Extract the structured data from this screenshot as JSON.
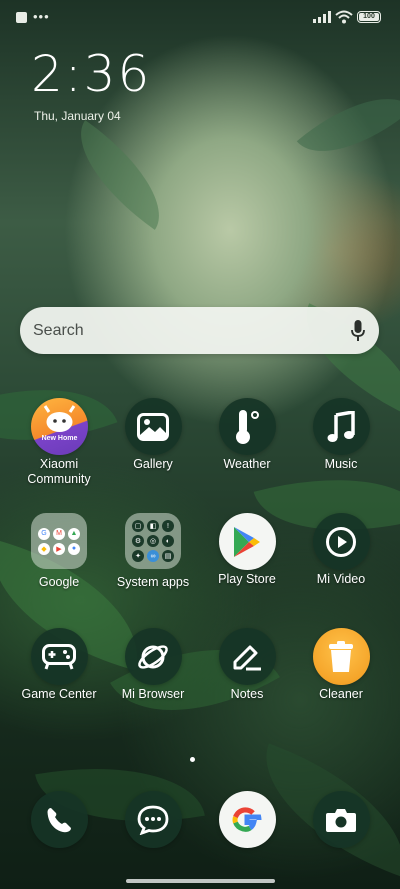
{
  "status_bar": {
    "battery_level": "100",
    "icons": [
      "notification-square-icon",
      "more-dots-icon",
      "signal-icon",
      "wifi-icon",
      "battery-icon"
    ]
  },
  "clock": {
    "time": "2:36",
    "date": "Thu, January 04"
  },
  "search": {
    "placeholder": "Search",
    "icon": "mic-icon"
  },
  "apps": [
    {
      "label_line1": "Xiaomi",
      "label_line2": "Community",
      "badge": "New Home",
      "icon": "xiaomi-community-icon"
    },
    {
      "label_line1": "Gallery",
      "icon": "gallery-icon"
    },
    {
      "label_line1": "Weather",
      "icon": "thermometer-icon"
    },
    {
      "label_line1": "Music",
      "icon": "music-note-icon"
    },
    {
      "label_line1": "Google",
      "icon": "folder-icon"
    },
    {
      "label_line1": "System apps",
      "icon": "folder-icon"
    },
    {
      "label_line1": "Play Store",
      "icon": "play-store-icon"
    },
    {
      "label_line1": "Mi Video",
      "icon": "play-circle-icon"
    },
    {
      "label_line1": "Game Center",
      "icon": "gamepad-icon"
    },
    {
      "label_line1": "Mi Browser",
      "icon": "planet-icon"
    },
    {
      "label_line1": "Notes",
      "icon": "pencil-icon"
    },
    {
      "label_line1": "Cleaner",
      "icon": "trash-icon"
    }
  ],
  "dock": [
    "phone-icon",
    "messages-icon",
    "google-icon",
    "camera-icon"
  ],
  "page_indicator": {
    "pages": 1,
    "current": 1
  },
  "colors": {
    "icon_bg": "#163426",
    "accent_orange": "#f5a52a",
    "google_blue": "#4285F4",
    "google_red": "#EA4335",
    "google_yellow": "#FBBC05",
    "google_green": "#34A853"
  }
}
